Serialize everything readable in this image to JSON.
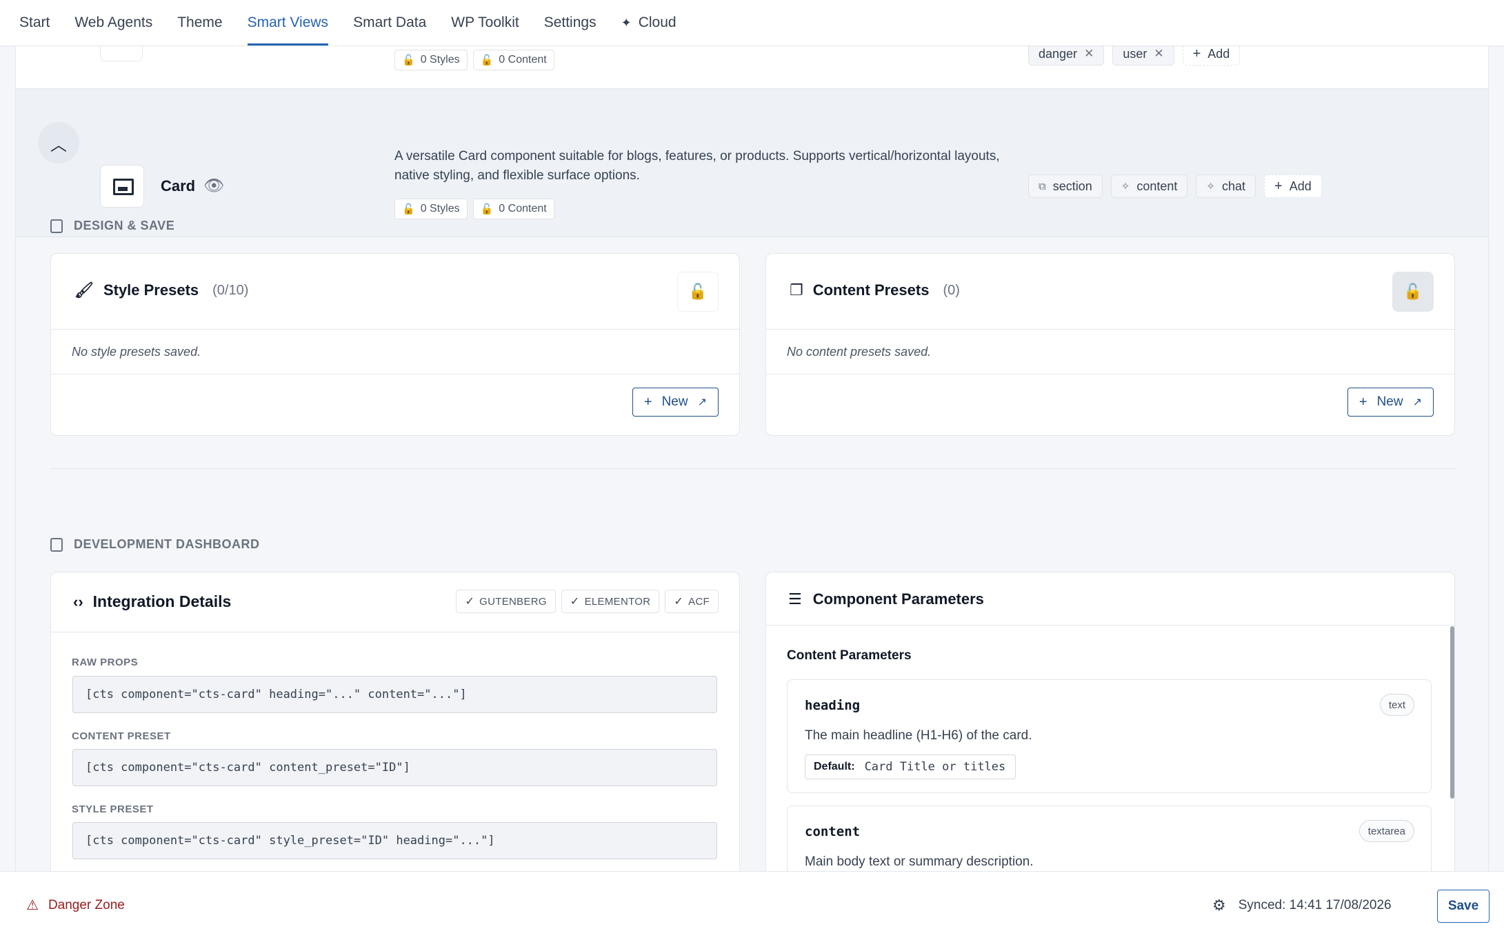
{
  "nav": {
    "tabs": [
      {
        "label": "Start"
      },
      {
        "label": "Web Agents"
      },
      {
        "label": "Theme"
      },
      {
        "label": "Smart Views"
      },
      {
        "label": "Smart Data"
      },
      {
        "label": "WP Toolkit"
      },
      {
        "label": "Settings"
      },
      {
        "label": "Cloud",
        "icon": "sparkle-icon"
      }
    ],
    "active_tab": "Smart Views"
  },
  "prev_row": {
    "styles_badge": "0 Styles",
    "content_badge": "0 Content",
    "tags": [
      "danger",
      "user"
    ],
    "add_label": "Add"
  },
  "card_row": {
    "name": "Card",
    "description": "A versatile Card component suitable for blogs, features, or products. Supports vertical/horizontal layouts, native styling, and flexible surface options.",
    "styles_badge": "0 Styles",
    "content_badge": "0 Content",
    "tags": [
      "section",
      "content",
      "chat"
    ],
    "add_label": "Add"
  },
  "design_save": {
    "heading": "DESIGN & SAVE",
    "style_presets": {
      "title": "Style Presets",
      "count": "(0/10)",
      "empty": "No style presets saved.",
      "new_label": "New"
    },
    "content_presets": {
      "title": "Content Presets",
      "count": "(0)",
      "empty": "No content presets saved.",
      "new_label": "New"
    }
  },
  "dev_dashboard": {
    "heading": "DEVELOPMENT DASHBOARD",
    "integration": {
      "title": "Integration Details",
      "compat": [
        "GUTENBERG",
        "ELEMENTOR",
        "ACF"
      ],
      "fields": [
        {
          "label": "RAW PROPS",
          "value": "[cts component=\"cts-card\" heading=\"...\" content=\"...\"]"
        },
        {
          "label": "CONTENT PRESET",
          "value": "[cts component=\"cts-card\" content_preset=\"ID\"]"
        },
        {
          "label": "STYLE PRESET",
          "value": "[cts component=\"cts-card\" style_preset=\"ID\" heading=\"...\"]"
        }
      ]
    },
    "parameters": {
      "title": "Component Parameters",
      "subheading": "Content Parameters",
      "items": [
        {
          "name": "heading",
          "type": "text",
          "description": "The main headline (H1-H6) of the card.",
          "default_label": "Default:",
          "default_value": "Card Title or titles"
        },
        {
          "name": "content",
          "type": "textarea",
          "description": "Main body text or summary description."
        }
      ]
    }
  },
  "footer": {
    "danger_label": "Danger Zone",
    "sync_text": "Synced: 14:41 17/08/2026",
    "save_label": "Save"
  },
  "colors": {
    "accent": "#2563b0",
    "danger": "#991b1b",
    "lock_active": "#7c3aed"
  }
}
